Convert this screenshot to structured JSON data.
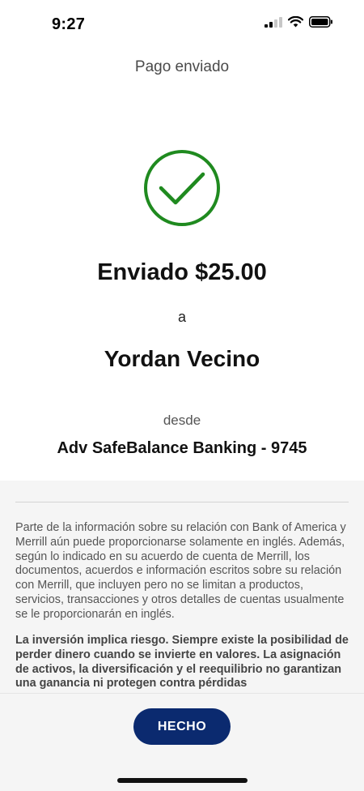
{
  "status_bar": {
    "time": "9:27",
    "signal_icon": "cellular-signal-icon",
    "wifi_icon": "wifi-icon",
    "battery_icon": "battery-icon"
  },
  "header": {
    "title": "Pago enviado"
  },
  "confirmation": {
    "icon": "check-circle-icon",
    "icon_color": "#1f8a1f",
    "amount_text": "Enviado $25.00",
    "to_label": "a",
    "recipient_name": "Yordan Vecino",
    "from_label": "desde",
    "account_name": "Adv SafeBalance Banking - 9745"
  },
  "disclosure": {
    "paragraph": "Parte de la información sobre su relación con Bank of America y Merrill aún puede proporcionarse solamente en inglés. Además, según lo indicado en su acuerdo de cuenta de Merrill, los documentos, acuerdos e información escritos sobre su relación con Merrill, que incluyen pero no se limitan a productos, servicios, transacciones y otros detalles de cuentas usualmente se le proporcionarán en inglés.",
    "risk_paragraph": "La inversión implica riesgo. Siempre existe la posibilidad de perder dinero cuando se invierte en valores. La asignación de activos, la diversificación y el reequilibrio no garantizan una ganancia ni protegen contra pérdidas"
  },
  "footer": {
    "done_label": "HECHO",
    "button_color": "#0b2a6f"
  }
}
